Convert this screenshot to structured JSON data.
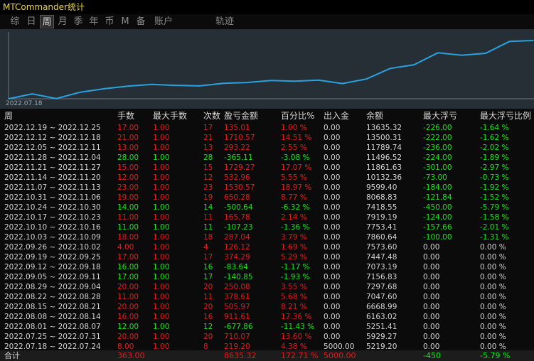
{
  "window": {
    "title": "MTCommander统计"
  },
  "tabs": [
    {
      "label": "综",
      "active": false
    },
    {
      "label": "日",
      "active": false
    },
    {
      "label": "周",
      "active": true
    },
    {
      "label": "月",
      "active": false
    },
    {
      "label": "季",
      "active": false
    },
    {
      "label": "年",
      "active": false
    },
    {
      "label": "币",
      "active": false
    },
    {
      "label": "M",
      "active": false
    },
    {
      "label": "备",
      "active": false
    },
    {
      "label": "账户",
      "active": false
    },
    {
      "label": "轨迹",
      "active": false
    }
  ],
  "chart": {
    "start_label": "2022.07.18",
    "line_color": "#29a3e0",
    "background": "#262e36"
  },
  "chart_data": {
    "type": "line",
    "x_start_label": "2022.07.18",
    "x_categories": [
      "2022.07.18",
      "2022.07.25",
      "2022.08.01",
      "2022.08.08",
      "2022.08.15",
      "2022.08.22",
      "2022.08.29",
      "2022.09.05",
      "2022.09.12",
      "2022.09.19",
      "2022.09.26",
      "2022.10.03",
      "2022.10.10",
      "2022.10.17",
      "2022.10.24",
      "2022.10.31",
      "2022.11.07",
      "2022.11.14",
      "2022.11.21",
      "2022.11.28",
      "2022.12.05",
      "2022.12.12",
      "2022.12.19"
    ],
    "values": [
      5219.2,
      5929.27,
      5251.41,
      6163.02,
      6668.99,
      7047.6,
      7297.68,
      7156.83,
      7073.19,
      7447.48,
      7573.6,
      7860.64,
      7753.41,
      7919.19,
      7418.55,
      8068.83,
      9599.4,
      10132.36,
      11861.63,
      11496.52,
      11789.74,
      13500.31,
      13635.32
    ]
  },
  "columns": [
    "周",
    "手数",
    "最大手数",
    "次数",
    "盈亏金额",
    "百分比%",
    "出入金",
    "余额",
    "最大浮亏",
    "最大浮亏比例"
  ],
  "rows": [
    {
      "week": "2022.12.19 ~ 2022.12.25",
      "lots": "17.00",
      "max_lots": "1.00",
      "count": "17",
      "pnl": "135.01",
      "pct": "1.00 %",
      "io": "0.00",
      "balance": "13635.32",
      "max_dd": "-226.00",
      "max_dd_pct": "-1.64 %",
      "pnl_color": "red",
      "dd_color": "green"
    },
    {
      "week": "2022.12.12 ~ 2022.12.18",
      "lots": "21.00",
      "max_lots": "1.00",
      "count": "21",
      "pnl": "1710.57",
      "pct": "14.51 %",
      "io": "0.00",
      "balance": "13500.31",
      "max_dd": "-222.00",
      "max_dd_pct": "-1.62 %",
      "pnl_color": "red",
      "dd_color": "green"
    },
    {
      "week": "2022.12.05 ~ 2022.12.11",
      "lots": "13.00",
      "max_lots": "1.00",
      "count": "13",
      "pnl": "293.22",
      "pct": "2.55 %",
      "io": "0.00",
      "balance": "11789.74",
      "max_dd": "-236.00",
      "max_dd_pct": "-2.02 %",
      "pnl_color": "red",
      "dd_color": "green"
    },
    {
      "week": "2022.11.28 ~ 2022.12.04",
      "lots": "28.00",
      "max_lots": "1.00",
      "count": "28",
      "pnl": "-365.11",
      "pct": "-3.08 %",
      "io": "0.00",
      "balance": "11496.52",
      "max_dd": "-224.00",
      "max_dd_pct": "-1.89 %",
      "pnl_color": "green",
      "dd_color": "green"
    },
    {
      "week": "2022.11.21 ~ 2022.11.27",
      "lots": "15.00",
      "max_lots": "1.00",
      "count": "15",
      "pnl": "1729.27",
      "pct": "17.07 %",
      "io": "0.00",
      "balance": "11861.63",
      "max_dd": "-301.00",
      "max_dd_pct": "-2.97 %",
      "pnl_color": "red",
      "dd_color": "green"
    },
    {
      "week": "2022.11.14 ~ 2022.11.20",
      "lots": "12.00",
      "max_lots": "1.00",
      "count": "12",
      "pnl": "532.96",
      "pct": "5.55 %",
      "io": "0.00",
      "balance": "10132.36",
      "max_dd": "-73.00",
      "max_dd_pct": "-0.73 %",
      "pnl_color": "red",
      "dd_color": "green"
    },
    {
      "week": "2022.11.07 ~ 2022.11.13",
      "lots": "23.00",
      "max_lots": "1.00",
      "count": "23",
      "pnl": "1530.57",
      "pct": "18.97 %",
      "io": "0.00",
      "balance": "9599.40",
      "max_dd": "-184.00",
      "max_dd_pct": "-1.92 %",
      "pnl_color": "red",
      "dd_color": "green"
    },
    {
      "week": "2022.10.31 ~ 2022.11.06",
      "lots": "19.00",
      "max_lots": "1.00",
      "count": "19",
      "pnl": "650.28",
      "pct": "8.77 %",
      "io": "0.00",
      "balance": "8068.83",
      "max_dd": "-121.84",
      "max_dd_pct": "-1.52 %",
      "pnl_color": "red",
      "dd_color": "green"
    },
    {
      "week": "2022.10.24 ~ 2022.10.30",
      "lots": "14.00",
      "max_lots": "1.00",
      "count": "14",
      "pnl": "-500.64",
      "pct": "-6.32 %",
      "io": "0.00",
      "balance": "7418.55",
      "max_dd": "-450.00",
      "max_dd_pct": "-5.79 %",
      "pnl_color": "green",
      "dd_color": "green"
    },
    {
      "week": "2022.10.17 ~ 2022.10.23",
      "lots": "11.00",
      "max_lots": "1.00",
      "count": "11",
      "pnl": "165.78",
      "pct": "2.14 %",
      "io": "0.00",
      "balance": "7919.19",
      "max_dd": "-124.00",
      "max_dd_pct": "-1.58 %",
      "pnl_color": "red",
      "dd_color": "green"
    },
    {
      "week": "2022.10.10 ~ 2022.10.16",
      "lots": "11.00",
      "max_lots": "1.00",
      "count": "11",
      "pnl": "-107.23",
      "pct": "-1.36 %",
      "io": "0.00",
      "balance": "7753.41",
      "max_dd": "-157.66",
      "max_dd_pct": "-2.01 %",
      "pnl_color": "green",
      "dd_color": "green"
    },
    {
      "week": "2022.10.03 ~ 2022.10.09",
      "lots": "18.00",
      "max_lots": "1.00",
      "count": "18",
      "pnl": "287.04",
      "pct": "3.79 %",
      "io": "0.00",
      "balance": "7860.64",
      "max_dd": "-100.00",
      "max_dd_pct": "-1.31 %",
      "pnl_color": "red",
      "dd_color": "green"
    },
    {
      "week": "2022.09.26 ~ 2022.10.02",
      "lots": "4.00",
      "max_lots": "1.00",
      "count": "4",
      "pnl": "126.12",
      "pct": "1.69 %",
      "io": "0.00",
      "balance": "7573.60",
      "max_dd": "0.00",
      "max_dd_pct": "0.00 %",
      "pnl_color": "red",
      "dd_color": "white"
    },
    {
      "week": "2022.09.19 ~ 2022.09.25",
      "lots": "17.00",
      "max_lots": "1.00",
      "count": "17",
      "pnl": "374.29",
      "pct": "5.29 %",
      "io": "0.00",
      "balance": "7447.48",
      "max_dd": "0.00",
      "max_dd_pct": "0.00 %",
      "pnl_color": "red",
      "dd_color": "white"
    },
    {
      "week": "2022.09.12 ~ 2022.09.18",
      "lots": "16.00",
      "max_lots": "1.00",
      "count": "16",
      "pnl": "-83.64",
      "pct": "-1.17 %",
      "io": "0.00",
      "balance": "7073.19",
      "max_dd": "0.00",
      "max_dd_pct": "0.00 %",
      "pnl_color": "green",
      "dd_color": "white"
    },
    {
      "week": "2022.09.05 ~ 2022.09.11",
      "lots": "17.00",
      "max_lots": "1.00",
      "count": "17",
      "pnl": "-140.85",
      "pct": "-1.93 %",
      "io": "0.00",
      "balance": "7156.83",
      "max_dd": "0.00",
      "max_dd_pct": "0.00 %",
      "pnl_color": "green",
      "dd_color": "white"
    },
    {
      "week": "2022.08.29 ~ 2022.09.04",
      "lots": "20.00",
      "max_lots": "1.00",
      "count": "20",
      "pnl": "250.08",
      "pct": "3.55 %",
      "io": "0.00",
      "balance": "7297.68",
      "max_dd": "0.00",
      "max_dd_pct": "0.00 %",
      "pnl_color": "red",
      "dd_color": "white"
    },
    {
      "week": "2022.08.22 ~ 2022.08.28",
      "lots": "11.00",
      "max_lots": "1.00",
      "count": "11",
      "pnl": "378.61",
      "pct": "5.68 %",
      "io": "0.00",
      "balance": "7047.60",
      "max_dd": "0.00",
      "max_dd_pct": "0.00 %",
      "pnl_color": "red",
      "dd_color": "white"
    },
    {
      "week": "2022.08.15 ~ 2022.08.21",
      "lots": "20.00",
      "max_lots": "1.00",
      "count": "20",
      "pnl": "505.97",
      "pct": "8.21 %",
      "io": "0.00",
      "balance": "6668.99",
      "max_dd": "0.00",
      "max_dd_pct": "0.00 %",
      "pnl_color": "red",
      "dd_color": "white"
    },
    {
      "week": "2022.08.08 ~ 2022.08.14",
      "lots": "16.00",
      "max_lots": "1.00",
      "count": "16",
      "pnl": "911.61",
      "pct": "17.36 %",
      "io": "0.00",
      "balance": "6163.02",
      "max_dd": "0.00",
      "max_dd_pct": "0.00 %",
      "pnl_color": "red",
      "dd_color": "white"
    },
    {
      "week": "2022.08.01 ~ 2022.08.07",
      "lots": "12.00",
      "max_lots": "1.00",
      "count": "12",
      "pnl": "-677.86",
      "pct": "-11.43 %",
      "io": "0.00",
      "balance": "5251.41",
      "max_dd": "0.00",
      "max_dd_pct": "0.00 %",
      "pnl_color": "green",
      "dd_color": "white"
    },
    {
      "week": "2022.07.25 ~ 2022.07.31",
      "lots": "20.00",
      "max_lots": "1.00",
      "count": "20",
      "pnl": "710.07",
      "pct": "13.60 %",
      "io": "0.00",
      "balance": "5929.27",
      "max_dd": "0.00",
      "max_dd_pct": "0.00 %",
      "pnl_color": "red",
      "dd_color": "white"
    },
    {
      "week": "2022.07.18 ~ 2022.07.24",
      "lots": "8.00",
      "max_lots": "1.00",
      "count": "8",
      "pnl": "219.20",
      "pct": "4.38 %",
      "io": "5000.00",
      "balance": "5219.20",
      "max_dd": "0.00",
      "max_dd_pct": "0.00 %",
      "pnl_color": "red",
      "dd_color": "white"
    }
  ],
  "totals": {
    "label": "合计",
    "lots": "363.00",
    "pnl": "8635.32",
    "pct": "172.71 %",
    "io": "5000.00",
    "max_dd": "-450",
    "max_dd_pct": "-5.79 %"
  },
  "colors": {
    "profit": "#e41b1b",
    "loss": "#19e619",
    "neutral": "#d4d4d4",
    "title": "#e8d84a"
  }
}
